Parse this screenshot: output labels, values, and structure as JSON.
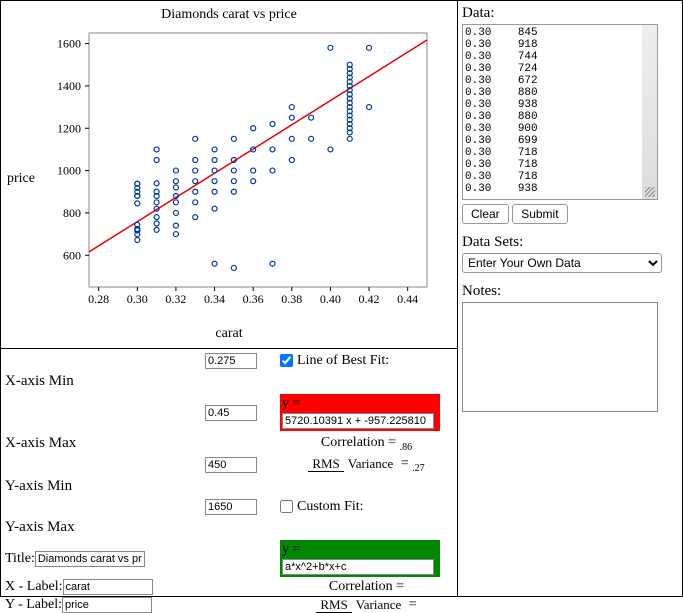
{
  "chart_data": {
    "type": "scatter",
    "title": "Diamonds carat vs price",
    "xlabel": "carat",
    "ylabel": "price",
    "xlim": [
      0.275,
      0.45
    ],
    "ylim": [
      450,
      1650
    ],
    "xticks": [
      0.28,
      0.3,
      0.32,
      0.34,
      0.36,
      0.38,
      0.4,
      0.42,
      0.44
    ],
    "yticks": [
      600,
      800,
      1000,
      1200,
      1400,
      1600
    ],
    "fit": {
      "slope": 5720.10391,
      "intercept": -957.22581
    },
    "series": [
      {
        "name": "diamonds",
        "points": [
          [
            0.3,
            845
          ],
          [
            0.3,
            918
          ],
          [
            0.3,
            744
          ],
          [
            0.3,
            724
          ],
          [
            0.3,
            672
          ],
          [
            0.3,
            880
          ],
          [
            0.3,
            938
          ],
          [
            0.3,
            880
          ],
          [
            0.3,
            900
          ],
          [
            0.3,
            699
          ],
          [
            0.3,
            718
          ],
          [
            0.3,
            718
          ],
          [
            0.3,
            718
          ],
          [
            0.3,
            938
          ],
          [
            0.31,
            720
          ],
          [
            0.31,
            750
          ],
          [
            0.31,
            780
          ],
          [
            0.31,
            820
          ],
          [
            0.31,
            850
          ],
          [
            0.31,
            880
          ],
          [
            0.31,
            900
          ],
          [
            0.31,
            940
          ],
          [
            0.31,
            1050
          ],
          [
            0.31,
            1100
          ],
          [
            0.32,
            700
          ],
          [
            0.32,
            740
          ],
          [
            0.32,
            800
          ],
          [
            0.32,
            850
          ],
          [
            0.32,
            880
          ],
          [
            0.32,
            920
          ],
          [
            0.32,
            950
          ],
          [
            0.32,
            1000
          ],
          [
            0.33,
            780
          ],
          [
            0.33,
            850
          ],
          [
            0.33,
            900
          ],
          [
            0.33,
            950
          ],
          [
            0.33,
            1000
          ],
          [
            0.33,
            1050
          ],
          [
            0.33,
            1150
          ],
          [
            0.34,
            560
          ],
          [
            0.34,
            820
          ],
          [
            0.34,
            900
          ],
          [
            0.34,
            950
          ],
          [
            0.34,
            1000
          ],
          [
            0.34,
            1050
          ],
          [
            0.34,
            1100
          ],
          [
            0.35,
            900
          ],
          [
            0.35,
            950
          ],
          [
            0.35,
            1000
          ],
          [
            0.35,
            1050
          ],
          [
            0.35,
            1150
          ],
          [
            0.36,
            950
          ],
          [
            0.36,
            1000
          ],
          [
            0.36,
            1100
          ],
          [
            0.36,
            1200
          ],
          [
            0.37,
            1000
          ],
          [
            0.37,
            1100
          ],
          [
            0.37,
            1220
          ],
          [
            0.38,
            1050
          ],
          [
            0.38,
            1150
          ],
          [
            0.38,
            1250
          ],
          [
            0.38,
            1300
          ],
          [
            0.39,
            1150
          ],
          [
            0.39,
            1250
          ],
          [
            0.4,
            1100
          ],
          [
            0.4,
            1580
          ],
          [
            0.41,
            1150
          ],
          [
            0.41,
            1180
          ],
          [
            0.41,
            1200
          ],
          [
            0.41,
            1220
          ],
          [
            0.41,
            1240
          ],
          [
            0.41,
            1260
          ],
          [
            0.41,
            1280
          ],
          [
            0.41,
            1300
          ],
          [
            0.41,
            1320
          ],
          [
            0.41,
            1340
          ],
          [
            0.41,
            1360
          ],
          [
            0.41,
            1380
          ],
          [
            0.41,
            1400
          ],
          [
            0.41,
            1420
          ],
          [
            0.41,
            1440
          ],
          [
            0.41,
            1460
          ],
          [
            0.41,
            1480
          ],
          [
            0.41,
            1500
          ],
          [
            0.42,
            1300
          ],
          [
            0.42,
            1580
          ],
          [
            0.35,
            540
          ],
          [
            0.37,
            560
          ]
        ]
      }
    ]
  },
  "controls": {
    "xmin_label": "X-axis Min",
    "xmin": "0.275",
    "xmax_label": "X-axis Max",
    "xmax": "0.45",
    "ymin_label": "Y-axis Min",
    "ymin": "450",
    "ymax_label": "Y-axis Max",
    "ymax": "1650",
    "title_label": "Title:",
    "title": "Diamonds carat vs price",
    "xlab_label": "X - Label:",
    "xlab": "carat",
    "ylab_label": "Y - Label:",
    "ylab": "price",
    "lobf_label": "Line of Best Fit:",
    "lobf_checked": true,
    "eq_prefix": "y =",
    "lobf_eq": "5720.10391 x + -957.225810",
    "corr_label": "Correlation =",
    "corr": ".86",
    "rms": "RMS",
    "var": "Variance",
    "eqsign": "=",
    "rmsval": ".27",
    "custom_label": "Custom Fit:",
    "custom_checked": false,
    "custom_eq": "a*x^2+b*x+c",
    "custom_corr_label": "Correlation ="
  },
  "right": {
    "data_h": "Data:",
    "data_text": "0.30\t845\n0.30\t918\n0.30\t744\n0.30\t724\n0.30\t672\n0.30\t880\n0.30\t938\n0.30\t880\n0.30\t900\n0.30\t699\n0.30\t718\n0.30\t718\n0.30\t718\n0.30\t938",
    "clear": "Clear",
    "submit": "Submit",
    "sets_h": "Data Sets:",
    "sets_sel": "Enter Your Own Data",
    "notes_h": "Notes:",
    "notes": ""
  }
}
